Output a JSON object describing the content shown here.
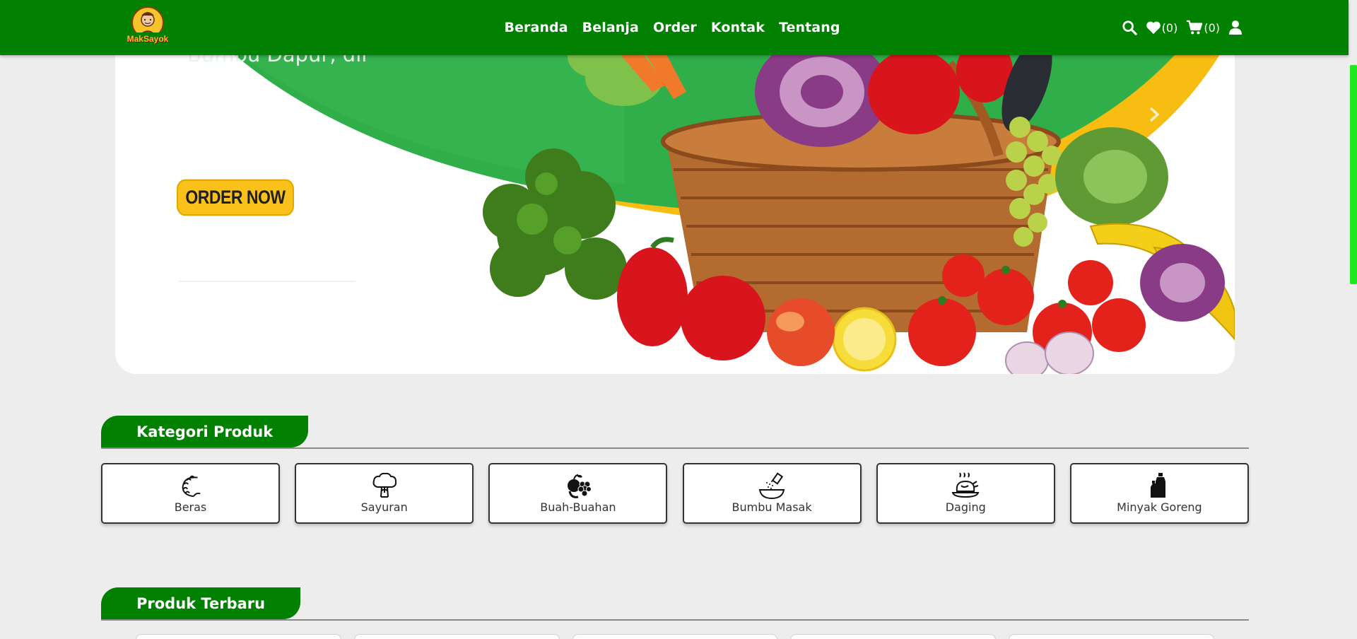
{
  "navbar": {
    "logo_text": "MakSayok",
    "links": [
      "Beranda",
      "Belanja",
      "Order",
      "Kontak",
      "Tentang"
    ],
    "wishlist_count": "(0)",
    "cart_count": "(0)",
    "icons": [
      "search-icon",
      "heart-icon",
      "cart-icon",
      "user-icon"
    ]
  },
  "hero": {
    "subtitle": "Bumbu Dapur, dll",
    "order_button": "ORDER NOW",
    "slides_count": 3,
    "active_slide": 1
  },
  "categories_section": {
    "title": "Kategori Produk",
    "items": [
      {
        "label": "Beras",
        "icon": "rice-icon"
      },
      {
        "label": "Sayuran",
        "icon": "broccoli-icon"
      },
      {
        "label": "Buah-Buahan",
        "icon": "fruits-icon"
      },
      {
        "label": "Bumbu Masak",
        "icon": "seasoning-icon"
      },
      {
        "label": "Daging",
        "icon": "meat-icon"
      },
      {
        "label": "Minyak Goreng",
        "icon": "oil-bottle-icon"
      }
    ]
  },
  "latest_section": {
    "title": "Produk Terbaru"
  },
  "colors": {
    "brand_green": "#018001",
    "accent_yellow": "#f9c11a",
    "page_bg": "#ededed"
  }
}
